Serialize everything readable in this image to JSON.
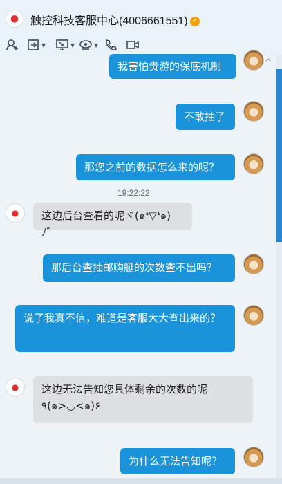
{
  "window": {
    "title": "触控科技客服中心(4006661551)",
    "verified_icon": "verified-badge-icon"
  },
  "toolbar": {
    "icons": [
      "add-contact-icon",
      "transfer-file-icon",
      "remote-desktop-icon",
      "app-center-icon",
      "phone-call-icon",
      "video-call-icon"
    ]
  },
  "messages": [
    {
      "id": "m1",
      "direction": "out",
      "text": "我害怕贵游的保底机制"
    },
    {
      "id": "m2",
      "direction": "out",
      "text": "不敢抽了"
    },
    {
      "id": "m3",
      "direction": "out",
      "text": "那您之前的数据怎么来的呢？"
    },
    {
      "id": "m4",
      "direction": "in",
      "text": "这边后台查看的呢ヾ(๑❛▽❛๑)ﾉ゛"
    },
    {
      "id": "m5",
      "direction": "out",
      "text": "那后台查抽邮购艇的次数查不出吗？"
    },
    {
      "id": "m6",
      "direction": "out",
      "text": "说了我真不信，难道是客服大大查出来的？"
    },
    {
      "id": "m7",
      "direction": "in",
      "text": "这边无法告知您具体剩余的次数的呢٩(๑>◡<๑)۶"
    },
    {
      "id": "m8",
      "direction": "out",
      "text": "为什么无法告知呢？"
    }
  ],
  "timestamp": "19:22:22",
  "colors": {
    "outgoing_bubble": "#1a93db",
    "incoming_bubble": "#dedfe2",
    "background": "#eef3f8",
    "accent": "#2a86d1"
  }
}
